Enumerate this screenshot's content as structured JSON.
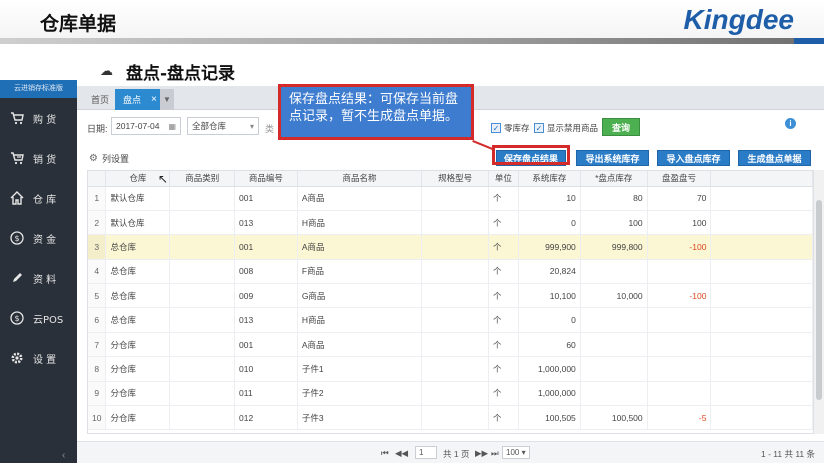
{
  "slide": {
    "title": "仓库单据",
    "logo_text": "Kingdee",
    "section_title": "盘点-盘点记录",
    "callout": "保存盘点结果：可保存当前盘点记录，暂不生成盘点单据。"
  },
  "sidebar": {
    "brand": "云进销存标准版",
    "items": [
      {
        "label": "购 货",
        "icon": "cart-icon"
      },
      {
        "label": "销 货",
        "icon": "sales-cart-icon"
      },
      {
        "label": "仓 库",
        "icon": "home-icon"
      },
      {
        "label": "资 金",
        "icon": "currency-icon"
      },
      {
        "label": "资 料",
        "icon": "pencil-icon"
      },
      {
        "label": "云POS",
        "icon": "pos-icon"
      },
      {
        "label": "设 置",
        "icon": "gear-icon"
      }
    ]
  },
  "tabs": {
    "home": "首页",
    "active": "盘点",
    "close": "×",
    "more": "▼"
  },
  "filter": {
    "date_label": "日期:",
    "date_value": "2017-07-04",
    "warehouse_value": "全部仓库",
    "cut_label": "类",
    "check_zero_stock": "零库存",
    "check_show_disabled": "显示禁用商品",
    "query_button": "查询"
  },
  "toolbar": {
    "column_settings": "列设置",
    "save_result": "保存盘点结果",
    "export_stock": "导出系统库存",
    "import_stock": "导入盘点库存",
    "generate_doc": "生成盘点单据"
  },
  "table": {
    "headers": [
      "",
      "仓库",
      "商品类别",
      "商品编号",
      "商品名称",
      "规格型号",
      "单位",
      "系统库存",
      "*盘点库存",
      "盘盈盘亏"
    ],
    "rows": [
      [
        "1",
        "默认仓库",
        "",
        "001",
        "A商品",
        "",
        "个",
        "10",
        "80",
        "70"
      ],
      [
        "2",
        "默认仓库",
        "",
        "013",
        "H商品",
        "",
        "个",
        "0",
        "100",
        "100"
      ],
      [
        "3",
        "总仓库",
        "",
        "001",
        "A商品",
        "",
        "个",
        "999,900",
        "999,800",
        "-100"
      ],
      [
        "4",
        "总仓库",
        "",
        "008",
        "F商品",
        "",
        "个",
        "20,824",
        "",
        ""
      ],
      [
        "5",
        "总仓库",
        "",
        "009",
        "G商品",
        "",
        "个",
        "10,100",
        "10,000",
        "-100"
      ],
      [
        "6",
        "总仓库",
        "",
        "013",
        "H商品",
        "",
        "个",
        "0",
        "",
        ""
      ],
      [
        "7",
        "分仓库",
        "",
        "001",
        "A商品",
        "",
        "个",
        "60",
        "",
        ""
      ],
      [
        "8",
        "分仓库",
        "",
        "010",
        "子件1",
        "",
        "个",
        "1,000,000",
        "",
        ""
      ],
      [
        "9",
        "分仓库",
        "",
        "011",
        "子件2",
        "",
        "个",
        "1,000,000",
        "",
        ""
      ],
      [
        "10",
        "分仓库",
        "",
        "012",
        "子件3",
        "",
        "个",
        "100,505",
        "100,500",
        "-5"
      ]
    ]
  },
  "pager": {
    "first": "⏮",
    "prev": "◀◀",
    "page_value": "1",
    "total_pages": "共 1 页",
    "next": "▶▶",
    "last": "⏭",
    "page_size": "100",
    "summary": "1 - 11    共 11 条"
  }
}
